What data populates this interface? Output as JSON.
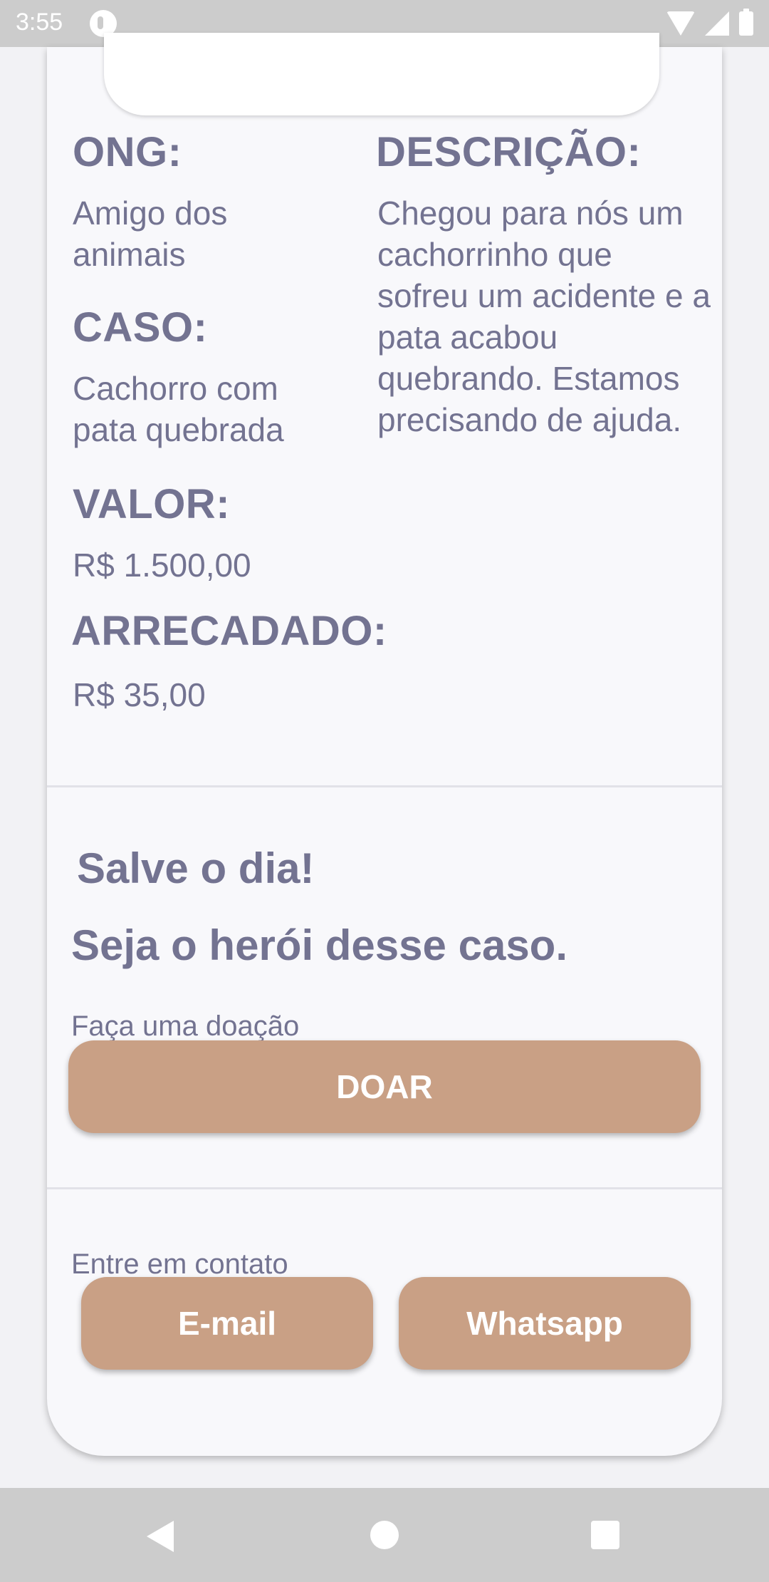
{
  "status_bar": {
    "time": "3:55",
    "icons": [
      "app-notification-icon",
      "wifi-icon",
      "signal-icon",
      "battery-icon"
    ]
  },
  "details": {
    "ong_label": "ONG:",
    "ong_value": "Amigo dos animais",
    "descricao_label": "DESCRIÇÃO:",
    "descricao_value": "Chegou para nós um cachorrinho que sofreu um acidente e a pata acabou quebrando. Estamos precisando de ajuda.",
    "caso_label": "CASO:",
    "caso_value": "Cachorro com pata quebrada",
    "valor_label": "VALOR:",
    "valor_value": "R$ 1.500,00",
    "arrecadado_label": "ARRECADADO:",
    "arrecadado_value": "R$ 35,00"
  },
  "donate": {
    "title1": "Salve o dia!",
    "title2": "Seja o herói desse caso.",
    "subtitle": "Faça uma doação",
    "button": "DOAR"
  },
  "contact": {
    "label": "Entre em contato",
    "email_button": "E-mail",
    "whatsapp_button": "Whatsapp"
  },
  "nav": {
    "icons": [
      "back-icon",
      "home-icon",
      "recents-icon"
    ]
  },
  "colors": {
    "text": "#737391",
    "button": "#c9a085",
    "card": "#f8f8fb",
    "system_bars": "#cccccc"
  }
}
